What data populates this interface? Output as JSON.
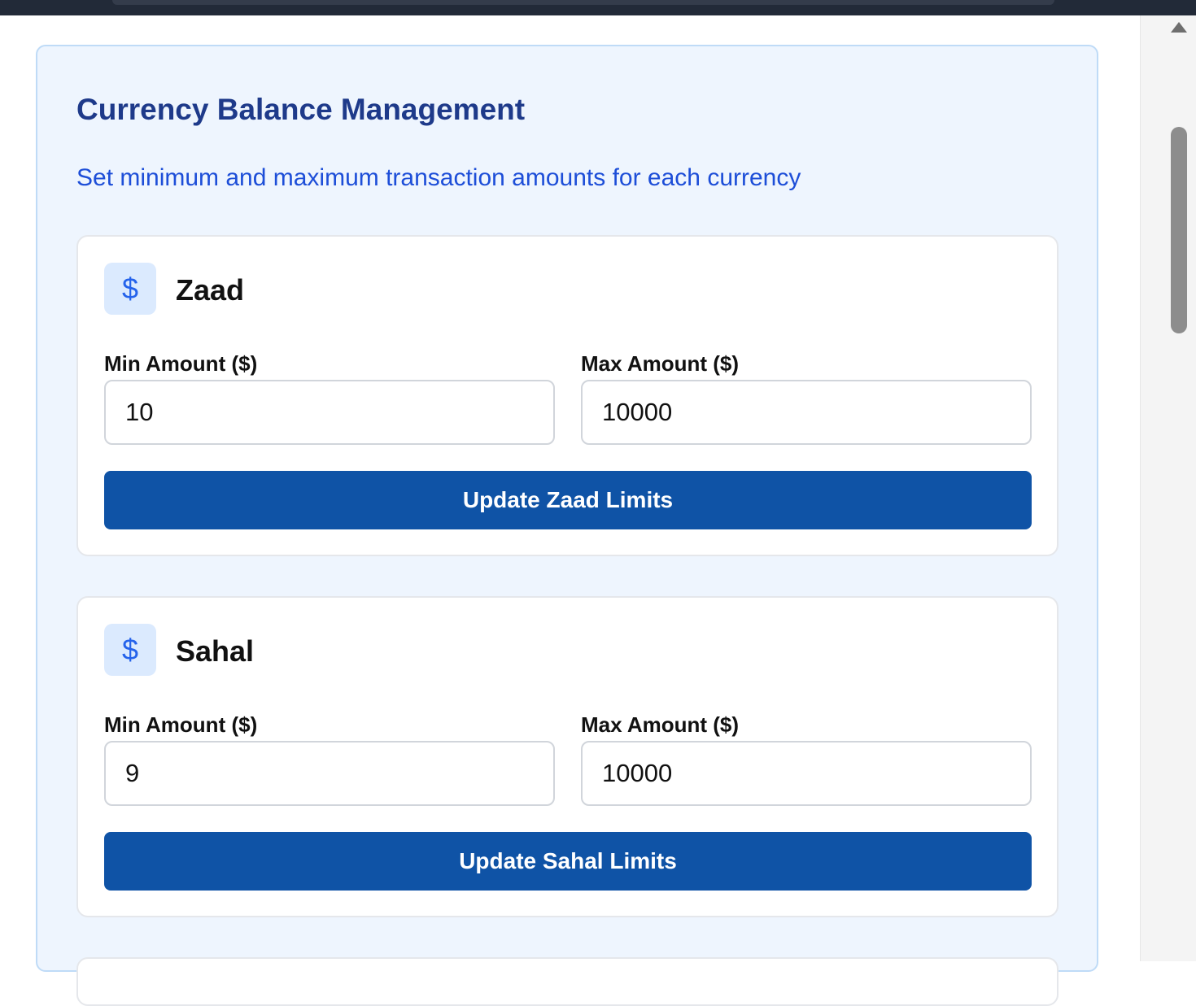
{
  "header": {
    "title": "Currency Balance Management",
    "subtitle": "Set minimum and maximum transaction amounts for each currency"
  },
  "currencies": [
    {
      "name": "Zaad",
      "icon": "dollar-sign-icon",
      "icon_glyph": "$",
      "min_label": "Min Amount ($)",
      "max_label": "Max Amount ($)",
      "min_value": "10",
      "max_value": "10000",
      "button_label": "Update Zaad Limits"
    },
    {
      "name": "Sahal",
      "icon": "dollar-sign-icon",
      "icon_glyph": "$",
      "min_label": "Min Amount ($)",
      "max_label": "Max Amount ($)",
      "min_value": "9",
      "max_value": "10000",
      "button_label": "Update Sahal Limits"
    }
  ],
  "colors": {
    "title": "#1e3a8a",
    "subtitle": "#1d4ed8",
    "panel_bg": "#eef5fe",
    "icon_bg": "#dbeafe",
    "icon_fg": "#2563eb",
    "button_bg": "#0f53a6"
  }
}
